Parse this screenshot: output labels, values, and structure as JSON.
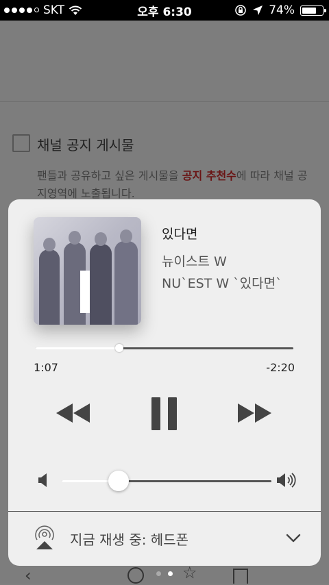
{
  "status_bar": {
    "carrier": "SKT",
    "time": "오후 6:30",
    "battery": "74%",
    "battery_level": 0.74
  },
  "background_app": {
    "notice_title": "채널 공지 게시물",
    "notice_desc_part1": "팬들과 공유하고 싶은 게시물을 ",
    "notice_desc_highlight": "공지 추천수",
    "notice_desc_part2": "에 따라 채널 공지영역에 노출됩니다."
  },
  "now_playing": {
    "song_title": "있다면",
    "artist": "뉴이스트 W",
    "album": "NU`EST W `있다면`",
    "elapsed": "1:07",
    "remaining": "-2:20",
    "progress": 0.325,
    "volume": 0.27,
    "airplay_label": "지금 재생 중: 헤드폰"
  },
  "icons": {
    "rewind": "rewind-icon",
    "pause": "pause-icon",
    "fast_forward": "fast-forward-icon",
    "volume_low": "speaker-low-icon",
    "volume_high": "speaker-high-icon",
    "airplay": "airplay-icon",
    "chevron": "chevron-down-icon"
  },
  "page_indicator": {
    "count": 2,
    "active": 2
  }
}
